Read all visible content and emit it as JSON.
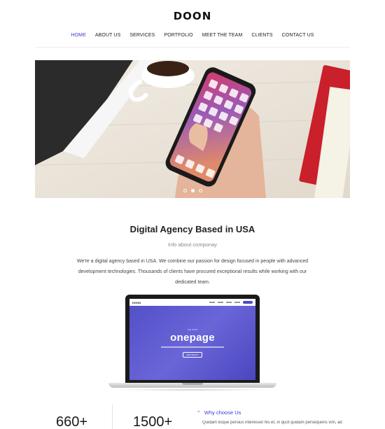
{
  "brand": {
    "logo_text": "DOON"
  },
  "nav": {
    "items": [
      {
        "label": "HOME",
        "active": true
      },
      {
        "label": "ABOUT US",
        "active": false
      },
      {
        "label": "SERVICES",
        "active": false
      },
      {
        "label": "PORTFOLIO",
        "active": false
      },
      {
        "label": "MEET THE TEAM",
        "active": false
      },
      {
        "label": "CLIENTS",
        "active": false
      },
      {
        "label": "CONTACT US",
        "active": false
      }
    ],
    "active_color": "#3b3bd8"
  },
  "hero": {
    "image": "hand-holding-smartphone-photo",
    "slides_total": 3,
    "active_slide": 2
  },
  "intro": {
    "title": "Digital Agency Based in USA",
    "subtitle": "Info about componay",
    "body": "We're a digital agency based in USA. We combine our passion for design focused in people with advanced development technologies. Thousands of clients have procured exceptional results while working with our dedicated team."
  },
  "laptop_mockup": {
    "logo_text": "DOON",
    "small_caption": "THE MOST",
    "headline": "onepage",
    "cta": "GET READY"
  },
  "stats": [
    {
      "value": "660+"
    },
    {
      "value": "1500+"
    }
  ],
  "why_choose": {
    "label": "Why choose Us",
    "text": "Quidam lisque persius interesset his et, in quot quidam persequeris vim, ad"
  }
}
